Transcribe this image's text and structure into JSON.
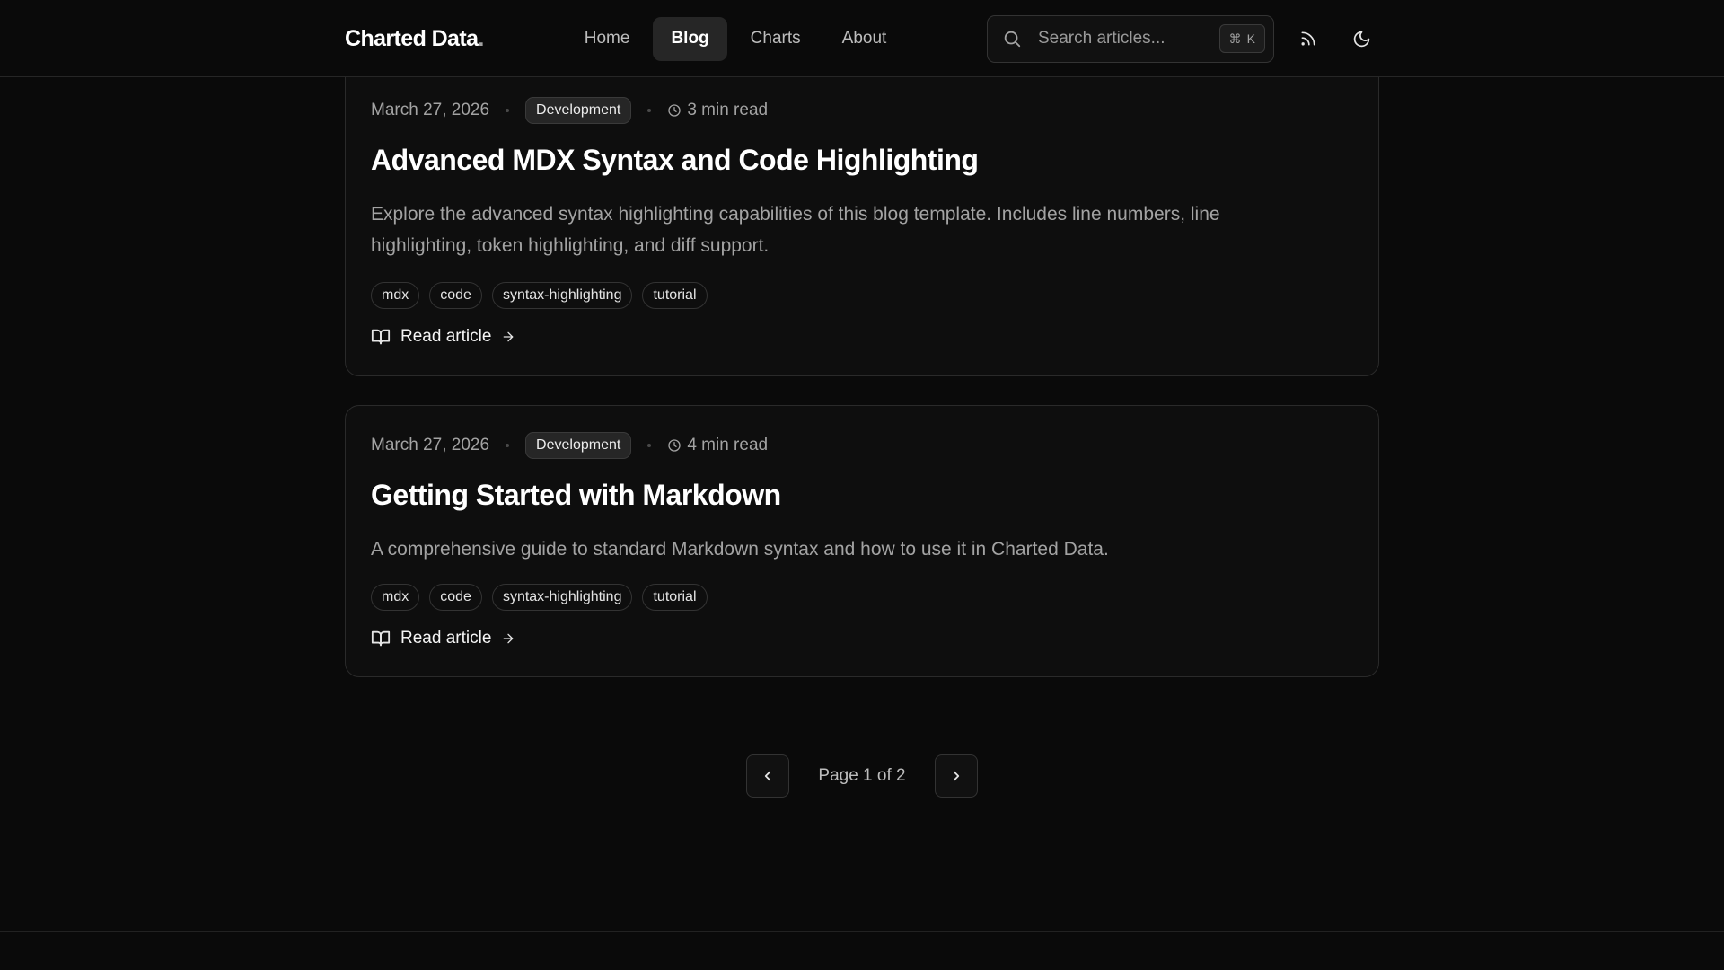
{
  "header": {
    "logo_text": "Charted Data",
    "logo_dot": ".",
    "nav": [
      {
        "label": "Home",
        "active": false
      },
      {
        "label": "Blog",
        "active": true
      },
      {
        "label": "Charts",
        "active": false
      },
      {
        "label": "About",
        "active": false
      }
    ],
    "search": {
      "placeholder": "Search articles...",
      "shortcut_symbol": "⌘",
      "shortcut_key": "K"
    }
  },
  "articles": [
    {
      "date": "March 27, 2026",
      "category": "Development",
      "read_time": "3 min read",
      "title": "Advanced MDX Syntax and Code Highlighting",
      "description_line1": "Explore the advanced syntax highlighting capabilities of this blog template. Includes line numbers, line",
      "description_line2": "highlighting, token highlighting, and diff support.",
      "tags": [
        "mdx",
        "code",
        "syntax-highlighting",
        "tutorial"
      ],
      "link_label": "Read article"
    },
    {
      "date": "March 27, 2026",
      "category": "Development",
      "read_time": "4 min read",
      "title": "Getting Started with Markdown",
      "description_line1": "A comprehensive guide to standard Markdown syntax and how to use it in Charted Data.",
      "tags": [
        "mdx",
        "code",
        "syntax-highlighting",
        "tutorial"
      ],
      "link_label": "Read article"
    }
  ],
  "pagination": {
    "label": "Page 1 of 2",
    "current_page": 1,
    "total_pages": 2
  },
  "icons": {
    "search": "search-icon",
    "rss": "rss-icon",
    "theme": "moon-icon",
    "clock": "clock-icon",
    "book": "book-open-icon",
    "arrow": "arrow-right-icon",
    "prev": "chevron-left-icon",
    "next": "chevron-right-icon"
  }
}
